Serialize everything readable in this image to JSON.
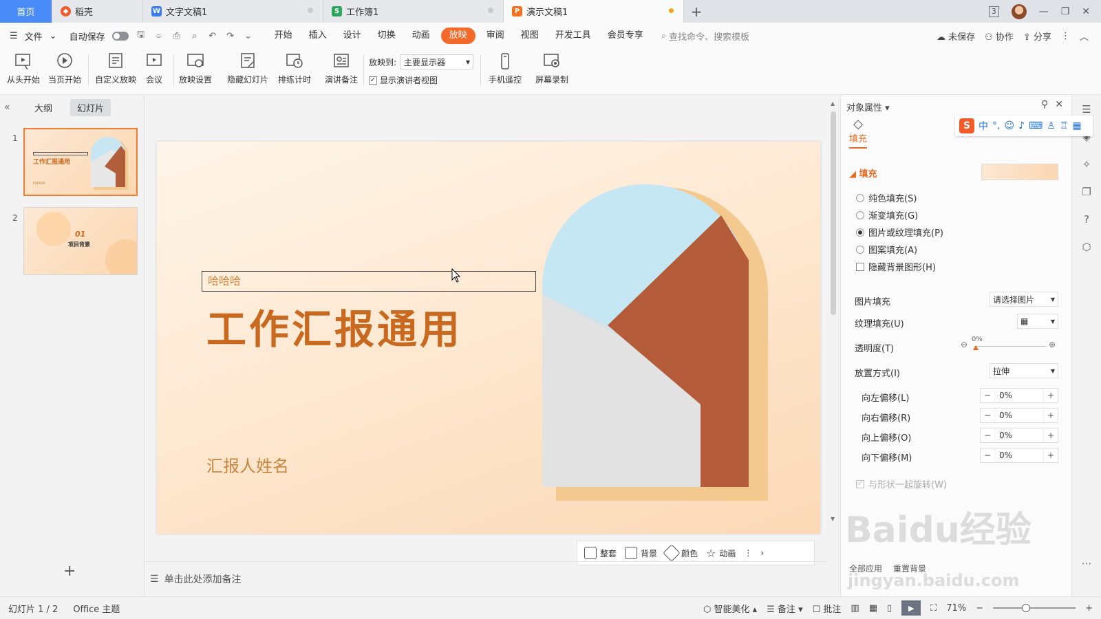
{
  "tabs": {
    "home": "首页",
    "items": [
      {
        "label": "稻壳",
        "icon": "daoke-icon"
      },
      {
        "label": "文字文稿1",
        "icon": "word-icon"
      },
      {
        "label": "工作簿1",
        "icon": "sheet-icon"
      },
      {
        "label": "演示文稿1",
        "icon": "ppt-icon"
      }
    ],
    "window_count": "3"
  },
  "menubar": {
    "file": "文件",
    "autosave": "自动保存",
    "tabs": [
      "开始",
      "插入",
      "设计",
      "切换",
      "动画",
      "放映",
      "审阅",
      "视图",
      "开发工具",
      "会员专享"
    ],
    "active_tab": "放映",
    "search_placeholder": "查找命令、搜索模板",
    "unsaved": "未保存",
    "collab": "协作",
    "share": "分享"
  },
  "ribbon": {
    "from_start": "从头开始",
    "from_current": "当页开始",
    "custom_show": "自定义放映",
    "meeting": "会议",
    "show_settings": "放映设置",
    "hide_slide": "隐藏幻灯片",
    "rehearse": "排练计时",
    "speaker_notes": "演讲备注",
    "play_to_label": "放映到:",
    "play_to_value": "主要显示器",
    "presenter_view": "显示演讲者视图",
    "phone_remote": "手机遥控",
    "screen_record": "屏幕录制"
  },
  "leftpanel": {
    "outline": "大纲",
    "slides": "幻灯片",
    "thumbs": [
      {
        "num": "1",
        "title": "工作汇报通用",
        "sub": "EMABA"
      },
      {
        "num": "2",
        "title": "01",
        "sub": "项目背景"
      }
    ]
  },
  "slide": {
    "textbox": "哈哈哈",
    "title": "工作汇报通用",
    "subtitle": "汇报人姓名"
  },
  "floatbar": {
    "fit": "整套",
    "background": "背景",
    "color": "颜色",
    "animation": "动画"
  },
  "notes_placeholder": "单击此处添加备注",
  "rpanel": {
    "title": "对象属性",
    "fill_tab": "填充",
    "section": "填充",
    "options": [
      {
        "label": "纯色填充(S)",
        "checked": false
      },
      {
        "label": "渐变填充(G)",
        "checked": false
      },
      {
        "label": "图片或纹理填充(P)",
        "checked": true
      },
      {
        "label": "图案填充(A)",
        "checked": false
      }
    ],
    "hide_bg": "隐藏背景图形(H)",
    "picture_fill_label": "图片填充",
    "picture_fill_value": "请选择图片",
    "texture_fill_label": "纹理填充(U)",
    "transparency_label": "透明度(T)",
    "transparency_value": "0%",
    "placement_label": "放置方式(I)",
    "placement_value": "拉伸",
    "offsets": [
      {
        "label": "向左偏移(L)",
        "value": "0%"
      },
      {
        "label": "向右偏移(R)",
        "value": "0%"
      },
      {
        "label": "向上偏移(O)",
        "value": "0%"
      },
      {
        "label": "向下偏移(M)",
        "value": "0%"
      }
    ],
    "rotate_with_shape": "与形状一起旋转(W)",
    "apply_all": "全部应用",
    "reset_bg": "重置背景"
  },
  "statusbar": {
    "slide_info": "幻灯片 1 / 2",
    "theme": "Office 主题",
    "beautify": "智能美化",
    "notes": "备注",
    "comments": "批注",
    "zoom": "71%"
  },
  "watermark": {
    "brand": "Baidu经验",
    "url": "jingyan.baidu.com"
  },
  "colors": {
    "accent": "#f36a2a",
    "title": "#c9691f",
    "home_tab": "#4a8cf7"
  }
}
